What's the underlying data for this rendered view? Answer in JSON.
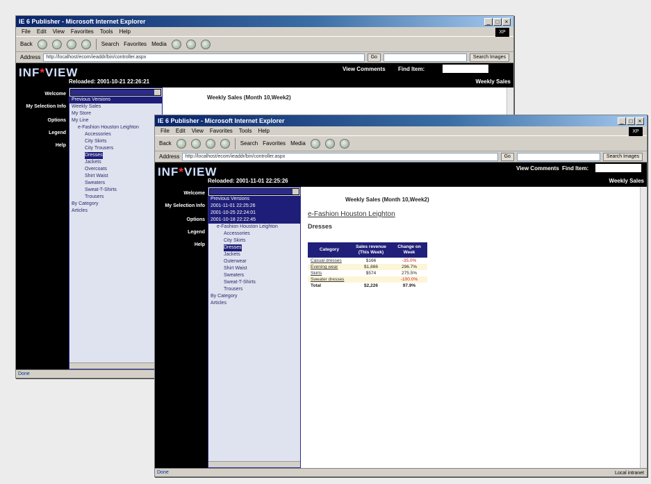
{
  "browser": {
    "title": "IE 6 Publisher - Microsoft Internet Explorer",
    "menu": [
      "File",
      "Edit",
      "View",
      "Favorites",
      "Tools",
      "Help"
    ],
    "toolbar": [
      "Back",
      "Search",
      "Favorites",
      "Media"
    ],
    "address_label": "Address",
    "address_value": "http://localhost/ecom/ieaddr/bin/controller.aspx",
    "go_label": "Go",
    "search_label": "Search Images",
    "status_left": "Done",
    "status_right": "Local intranet",
    "xp_badge": "XP"
  },
  "app": {
    "logo_main": "INF",
    "logo_star": "*",
    "logo_tail": "VIEW",
    "reloaded_back": "Reloaded: 2001-10-21 22:26:21",
    "reloaded_front": "Reloaded: 2001-11-01 22:25:26",
    "view_comments": "View Comments",
    "find_item": "Find Item:",
    "weekly_sales": "Weekly Sales"
  },
  "nav": [
    "Welcome",
    "My Selection Info",
    "Options",
    "Legend",
    "Help"
  ],
  "report_panel_back": {
    "selected": "Previous Versions",
    "items": [
      "Weekly Sales",
      "My Store",
      "My Line"
    ],
    "tree_root": "e-Fashion Houston Leighton",
    "tree": [
      "Accessories",
      "City Skirts",
      "City Trousers",
      "Dresses",
      "Jackets",
      "Overcoats",
      "Shirt Waist",
      "Sweaters",
      "Sweat-T-Shirts",
      "Trousers"
    ],
    "tail": [
      "By Category",
      "Articles"
    ]
  },
  "report_panel_front": {
    "selected": "Previous Versions",
    "versions": [
      "Previous Versions",
      "2001-11-01 22:25:26",
      "2001-10-25 22:24:01",
      "2001-10-18 22:22:45"
    ],
    "tree_root": "e-Fashion Houston Leighton",
    "tree": [
      "Accessories",
      "City Skirts",
      "Dresses",
      "Jackets",
      "Outerwear",
      "Shirt Waist",
      "Sweaters",
      "Sweat-T-Shirts",
      "Trousers"
    ],
    "tail": [
      "By Category",
      "Articles"
    ]
  },
  "report": {
    "heading": "Weekly Sales (Month 10,Week2)",
    "store": "e-Fashion Houston Leighton",
    "section": "Dresses",
    "columns": [
      "Category",
      "Sales revenue (This Week)",
      "Change on Week"
    ],
    "rows": [
      {
        "category": "Casual dresses",
        "revenue": "$166",
        "change": "-35.0%",
        "neg": true
      },
      {
        "category": "Evening wear",
        "revenue": "$1,886",
        "change": "296.7%",
        "neg": false
      },
      {
        "category": "Skirts",
        "revenue": "$574",
        "change": "275.5%",
        "neg": false
      },
      {
        "category": "Sweater dresses",
        "revenue": "",
        "change": "-100.0%",
        "neg": true
      }
    ],
    "total": {
      "category": "Total",
      "revenue": "$2,226",
      "change": "97.9%"
    }
  },
  "colors": {
    "nav_bg": "#000000",
    "table_header": "#20207a",
    "row_alt": "#fdf5d8",
    "negative": "#cc2020"
  }
}
